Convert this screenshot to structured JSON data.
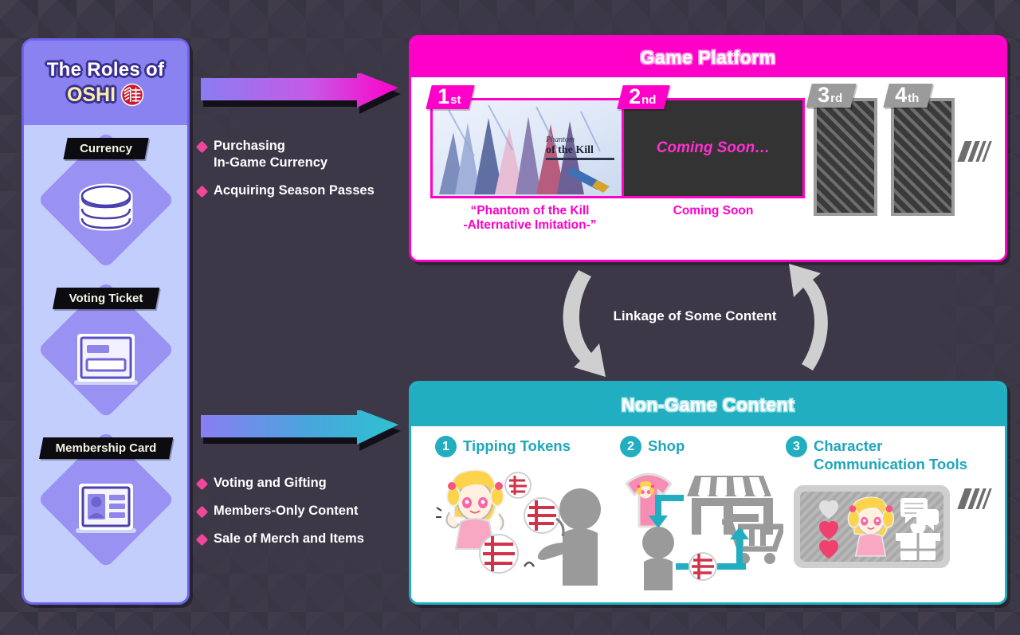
{
  "background": {
    "color": "#3c3847",
    "pattern": "triangle-geometric"
  },
  "left_panel": {
    "title_line1": "The Roles of",
    "title_line2": "OSHI",
    "emblem": "oshi-seal-icon",
    "accent_color": "#8a82f0",
    "items": [
      {
        "label": "Currency",
        "icon": "coin-stack-icon"
      },
      {
        "label": "Voting Ticket",
        "icon": "ticket-icon"
      },
      {
        "label": "Membership Card",
        "icon": "id-card-icon"
      }
    ]
  },
  "connectors": [
    {
      "id": "top",
      "arrow_icon": "right-arrow-icon",
      "gradient_from": "#8a7df2",
      "gradient_to": "#ff00c8",
      "bullets": [
        "Purchasing\nIn-Game Currency",
        "Acquiring Season Passes"
      ]
    },
    {
      "id": "bottom",
      "arrow_icon": "right-arrow-icon",
      "gradient_from": "#8a7df2",
      "gradient_to": "#2ec2cf",
      "bullets": [
        "Voting and Gifting",
        "Members-Only Content",
        "Sale of Merch and Items"
      ]
    }
  ],
  "game_platform": {
    "title": "Game Platform",
    "accent_color": "#ff00c8",
    "slots": [
      {
        "rank_num": "1",
        "rank_suffix": "st",
        "state": "released",
        "caption": "“Phantom of the Kill\n-Alternative Imitation-”",
        "artwork_title_line1": "Phantom",
        "artwork_title_line2": "of the Kill"
      },
      {
        "rank_num": "2",
        "rank_suffix": "nd",
        "state": "coming-soon",
        "placeholder_text": "Coming Soon…",
        "caption": "Coming Soon"
      },
      {
        "rank_num": "3",
        "rank_suffix": "rd",
        "state": "hatched",
        "caption": ""
      },
      {
        "rank_num": "4",
        "rank_suffix": "th",
        "state": "hatched",
        "caption": ""
      }
    ],
    "more_indicator": "slash-marks-icon"
  },
  "linkage": {
    "label": "Linkage of Some Content",
    "arrow_icon": "curved-cycle-arrows-icon"
  },
  "non_game_content": {
    "title": "Non-Game Content",
    "accent_color": "#21aec0",
    "features": [
      {
        "number": "1",
        "title": "Tipping Tokens",
        "illustration": "girl-throwing-tokens-icon"
      },
      {
        "number": "2",
        "title": "Shop",
        "illustration": "tshirt-store-cart-icon"
      },
      {
        "number": "3",
        "title": "Character\nCommunication Tools",
        "illustration": "character-chat-screen-icon"
      }
    ],
    "more_indicator": "slash-marks-icon"
  }
}
